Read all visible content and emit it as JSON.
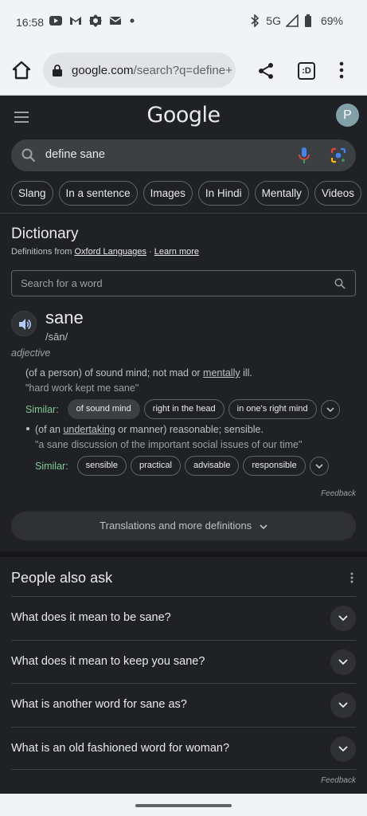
{
  "status_bar": {
    "time": "16:58",
    "network": "5G",
    "battery": "69%",
    "left_icons": [
      "youtube-icon",
      "gmail-icon",
      "brightness-icon",
      "mail-icon",
      "dot-icon"
    ],
    "right_icons": [
      "bluetooth-icon",
      "signal-icon",
      "battery-icon"
    ]
  },
  "browser": {
    "url_main": "google.com",
    "url_path": "/search?q=define+",
    "tabs_label": ":D"
  },
  "google": {
    "logo": "Google",
    "avatar_letter": "P",
    "query": "define sane",
    "chips": [
      "Slang",
      "In a sentence",
      "Images",
      "In Hindi",
      "Mentally",
      "Videos"
    ]
  },
  "dictionary": {
    "title": "Dictionary",
    "source_prefix": "Definitions from ",
    "source_name": "Oxford Languages",
    "separator": " · ",
    "learn_more": "Learn more",
    "search_placeholder": "Search for a word",
    "word": "sane",
    "phonetic": "/sān/",
    "part_of_speech": "adjective",
    "definitions": [
      {
        "pre": "(of a person) of sound mind; not mad or ",
        "link": "mentally",
        "post": " ill.",
        "example": "\"hard work kept me sane\"",
        "similar_label": "Similar:",
        "similar": [
          "of sound mind",
          "right in the head",
          "in one's right mind"
        ]
      },
      {
        "pre": "(of an ",
        "link": "undertaking",
        "post": " or manner) reasonable; sensible.",
        "example": "\"a sane discussion of the important social issues of our time\"",
        "similar_label": "Similar:",
        "similar": [
          "sensible",
          "practical",
          "advisable",
          "responsible"
        ]
      }
    ],
    "feedback": "Feedback",
    "translations_button": "Translations and more definitions"
  },
  "people_also_ask": {
    "title": "People also ask",
    "questions": [
      "What does it mean to be sane?",
      "What does it mean to keep you sane?",
      "What is another word for sane as?",
      "What is an old fashioned word for woman?"
    ],
    "feedback": "Feedback"
  },
  "colors": {
    "background": "#202124",
    "chrome": "#f1f3f4",
    "similar_label": "#81c995",
    "mic_blue": "#4285f4"
  }
}
